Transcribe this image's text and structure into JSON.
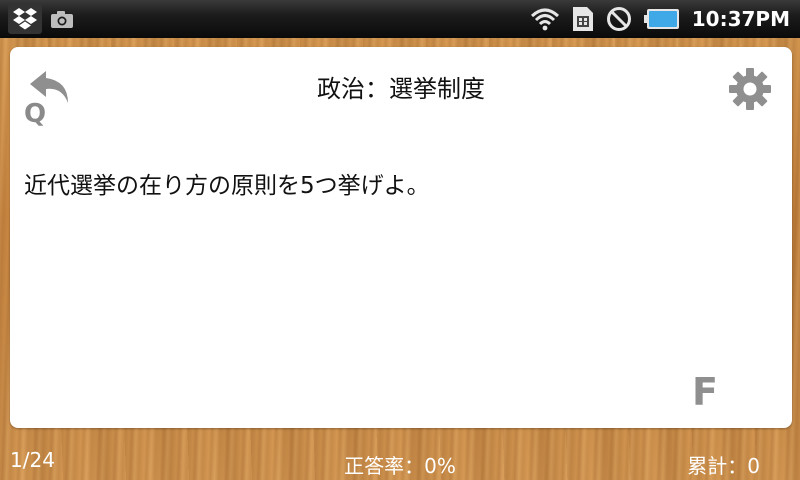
{
  "status_bar": {
    "left_icons": [
      "dropbox-icon",
      "camera-icon"
    ],
    "right_icons": [
      "wifi-icon",
      "sim-card-icon",
      "no-signal-icon",
      "battery-icon"
    ],
    "battery_color": "#3fa9e8",
    "time": "10:37PM"
  },
  "card": {
    "title": "政治：選挙制度",
    "back_label": "Q",
    "question": "近代選挙の在り方の原則を5つ挙げよ。",
    "flip_label": "F"
  },
  "footer": {
    "progress": "1/24",
    "correct_rate": "正答率：0%",
    "total": "累計：0"
  }
}
